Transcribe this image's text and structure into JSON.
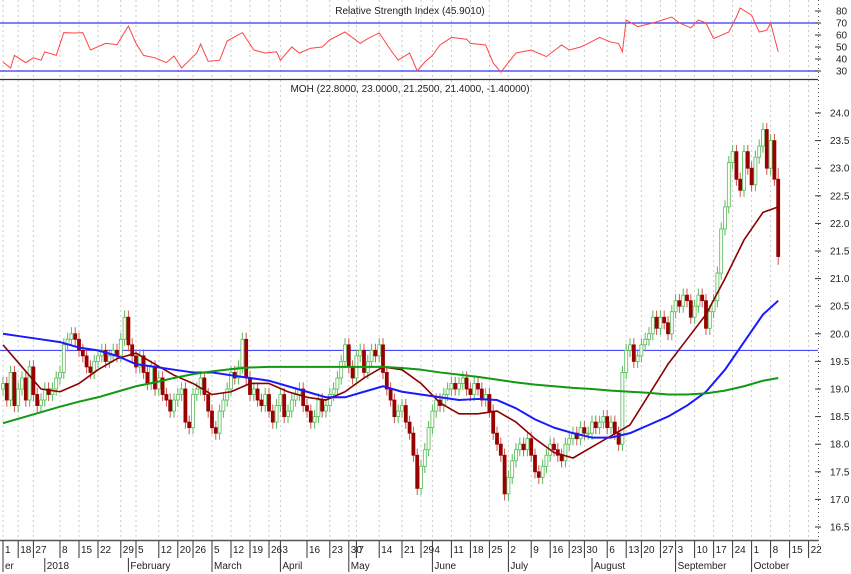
{
  "chart_data": {
    "type": "candlestick",
    "symbol": "MOH",
    "rsi_title": "Relative Strength Index (45.9010)",
    "price_title": "MOH (22.8000, 23.0000, 21.2500, 21.4000, -1.40000)",
    "last_bar": {
      "open": 22.8,
      "high": 23.0,
      "low": 21.25,
      "close": 21.4,
      "change": -1.4
    },
    "price_ylim": [
      16.25,
      24.5
    ],
    "price_ticks": [
      "24.0",
      "23.5",
      "23.0",
      "22.5",
      "22.0",
      "21.5",
      "21.0",
      "20.5",
      "20.0",
      "19.5",
      "19.0",
      "18.5",
      "18.0",
      "17.5",
      "17.0",
      "16.5"
    ],
    "rsi_ticks": [
      "80",
      "70",
      "60",
      "50",
      "40",
      "30"
    ],
    "rsi_levels": [
      70,
      30
    ],
    "price_hline": 19.7,
    "closes": [
      19.1,
      18.8,
      19.3,
      18.7,
      19.0,
      19.2,
      18.8,
      19.4,
      18.9,
      18.7,
      18.8,
      19.0,
      18.9,
      19.0,
      19.2,
      19.3,
      19.8,
      19.9,
      20.0,
      19.9,
      19.7,
      19.6,
      19.4,
      19.3,
      19.5,
      19.6,
      19.7,
      19.5,
      19.6,
      19.7,
      19.6,
      19.9,
      20.3,
      19.8,
      19.6,
      19.4,
      19.6,
      19.3,
      19.1,
      19.4,
      19.0,
      19.2,
      18.9,
      18.8,
      18.6,
      18.8,
      18.9,
      19.0,
      18.4,
      18.3,
      18.9,
      19.0,
      19.2,
      18.9,
      18.6,
      18.3,
      18.2,
      18.6,
      18.8,
      19.0,
      19.3,
      19.2,
      19.4,
      19.9,
      19.2,
      18.9,
      19.0,
      18.8,
      18.7,
      18.9,
      18.6,
      18.4,
      18.7,
      18.9,
      18.5,
      18.6,
      18.8,
      18.9,
      19.0,
      18.7,
      18.6,
      18.4,
      18.5,
      18.8,
      18.6,
      18.7,
      18.9,
      19.0,
      19.2,
      19.5,
      19.8,
      19.4,
      19.2,
      19.6,
      19.7,
      19.3,
      19.5,
      19.7,
      19.6,
      19.8,
      19.3,
      19.0,
      18.8,
      18.5,
      18.6,
      18.7,
      18.4,
      18.2,
      17.8,
      17.2,
      17.6,
      17.9,
      18.3,
      18.6,
      18.8,
      18.7,
      18.9,
      19.0,
      19.1,
      19.0,
      19.1,
      19.2,
      19.0,
      18.9,
      19.1,
      19.0,
      18.8,
      18.9,
      18.6,
      18.2,
      18.0,
      17.8,
      17.1,
      17.4,
      17.7,
      17.9,
      18.0,
      17.9,
      18.1,
      17.8,
      17.5,
      17.4,
      17.6,
      17.8,
      18.0,
      17.9,
      17.8,
      17.7,
      18.0,
      18.1,
      18.2,
      18.1,
      18.3,
      18.2,
      18.2,
      18.4,
      18.3,
      18.4,
      18.5,
      18.3,
      18.4,
      18.2,
      18.0,
      19.3,
      19.7,
      19.8,
      19.5,
      19.6,
      19.8,
      19.9,
      20.0,
      20.3,
      20.1,
      20.3,
      20.2,
      20.0,
      20.4,
      20.6,
      20.5,
      20.7,
      20.6,
      20.3,
      20.5,
      20.7,
      20.6,
      20.1,
      20.4,
      20.6,
      21.1,
      21.9,
      22.3,
      23.1,
      23.3,
      22.8,
      22.6,
      23.3,
      23.0,
      22.7,
      23.2,
      23.4,
      23.7,
      23.0,
      23.5,
      22.8,
      21.4
    ],
    "ma_sample_step": 5,
    "series": [
      {
        "name": "MA short",
        "color": "#8b0000",
        "values": [
          19.8,
          19.4,
          19.0,
          18.95,
          19.1,
          19.35,
          19.55,
          19.65,
          19.45,
          19.25,
          19.1,
          18.9,
          18.95,
          19.1,
          19.1,
          18.95,
          18.85,
          18.8,
          18.95,
          19.2,
          19.4,
          19.35,
          19.1,
          18.75,
          18.55,
          18.55,
          18.6,
          18.4,
          18.1,
          17.85,
          17.75,
          17.95,
          18.15,
          18.35,
          18.9,
          19.45,
          19.9,
          20.35,
          21.0,
          21.7,
          22.2,
          22.3
        ]
      },
      {
        "name": "MA medium",
        "color": "#1a1aff",
        "values": [
          20.0,
          19.95,
          19.9,
          19.85,
          19.75,
          19.7,
          19.6,
          19.45,
          19.4,
          19.35,
          19.3,
          19.3,
          19.25,
          19.2,
          19.15,
          19.05,
          18.95,
          18.85,
          18.85,
          18.95,
          19.05,
          18.95,
          18.9,
          18.85,
          18.8,
          18.82,
          18.8,
          18.65,
          18.45,
          18.3,
          18.2,
          18.12,
          18.12,
          18.2,
          18.35,
          18.5,
          18.7,
          18.95,
          19.35,
          19.85,
          20.35,
          20.6
        ]
      },
      {
        "name": "MA long",
        "color": "#119911",
        "values": [
          18.38,
          18.48,
          18.58,
          18.68,
          18.77,
          18.85,
          18.95,
          19.05,
          19.12,
          19.2,
          19.27,
          19.32,
          19.36,
          19.39,
          19.4,
          19.4,
          19.4,
          19.4,
          19.4,
          19.4,
          19.4,
          19.38,
          19.35,
          19.3,
          19.26,
          19.22,
          19.17,
          19.12,
          19.08,
          19.05,
          19.02,
          19.0,
          18.97,
          18.95,
          18.93,
          18.9,
          18.9,
          18.92,
          18.97,
          19.05,
          19.15,
          19.2
        ]
      }
    ],
    "rsi": [
      [
        0,
        37.5
      ],
      [
        2,
        32.5
      ],
      [
        3,
        43
      ],
      [
        6,
        37
      ],
      [
        8,
        41
      ],
      [
        10,
        39
      ],
      [
        11,
        46
      ],
      [
        14,
        43
      ],
      [
        16,
        62
      ],
      [
        19,
        61.7
      ],
      [
        21,
        62
      ],
      [
        23,
        47.5
      ],
      [
        27,
        53
      ],
      [
        30,
        52
      ],
      [
        33,
        67.5
      ],
      [
        35,
        53
      ],
      [
        37,
        43
      ],
      [
        40,
        41
      ],
      [
        43,
        37
      ],
      [
        45,
        42.5
      ],
      [
        47,
        32.5
      ],
      [
        51,
        45
      ],
      [
        52,
        52.5
      ],
      [
        54,
        38
      ],
      [
        57,
        39
      ],
      [
        59,
        55
      ],
      [
        63,
        62
      ],
      [
        66,
        47.5
      ],
      [
        69,
        45
      ],
      [
        72,
        46
      ],
      [
        73,
        39
      ],
      [
        76,
        50
      ],
      [
        78,
        45
      ],
      [
        81,
        49
      ],
      [
        84,
        50
      ],
      [
        86,
        56
      ],
      [
        90,
        62.5
      ],
      [
        94,
        53
      ],
      [
        96,
        57
      ],
      [
        99,
        61.7
      ],
      [
        102,
        47.5
      ],
      [
        104,
        39
      ],
      [
        107,
        45
      ],
      [
        109,
        30
      ],
      [
        111,
        37.5
      ],
      [
        113,
        43
      ],
      [
        115,
        51.7
      ],
      [
        118,
        58
      ],
      [
        122,
        56.5
      ],
      [
        123,
        53
      ],
      [
        127,
        51.7
      ],
      [
        129,
        36.7
      ],
      [
        131,
        29
      ],
      [
        135,
        45
      ],
      [
        139,
        47.5
      ],
      [
        143,
        42
      ],
      [
        147,
        51.7
      ],
      [
        149,
        47.5
      ],
      [
        152,
        50
      ],
      [
        154,
        53
      ],
      [
        157,
        58
      ],
      [
        160,
        54
      ],
      [
        162,
        53
      ],
      [
        163,
        46
      ],
      [
        164,
        72.5
      ],
      [
        167,
        67
      ],
      [
        171,
        70
      ],
      [
        176,
        75
      ],
      [
        178,
        70
      ],
      [
        181,
        66
      ],
      [
        183,
        72.5
      ],
      [
        185,
        70
      ],
      [
        187,
        57
      ],
      [
        191,
        62.5
      ],
      [
        193,
        75
      ],
      [
        194,
        82.5
      ],
      [
        197,
        76.5
      ],
      [
        199,
        62.5
      ],
      [
        201,
        64
      ],
      [
        202,
        70
      ],
      [
        204,
        46
      ]
    ],
    "date_ticks": [
      [
        "1",
        0
      ],
      [
        "18",
        4
      ],
      [
        "27",
        8
      ],
      [
        "8",
        15
      ],
      [
        "15",
        20
      ],
      [
        "22",
        25
      ],
      [
        "29",
        31
      ],
      [
        "5",
        35
      ],
      [
        "12",
        41
      ],
      [
        "20",
        46
      ],
      [
        "26",
        50
      ],
      [
        "5",
        55
      ],
      [
        "12",
        60
      ],
      [
        "19",
        65
      ],
      [
        "26",
        70
      ],
      [
        "3",
        73
      ],
      [
        "16",
        80
      ],
      [
        "23",
        86
      ],
      [
        "30",
        91
      ],
      [
        "7",
        93
      ],
      [
        "14",
        99
      ],
      [
        "21",
        105
      ],
      [
        "29",
        110
      ],
      [
        "4",
        113
      ],
      [
        "11",
        118
      ],
      [
        "18",
        123
      ],
      [
        "25",
        128
      ],
      [
        "2",
        133
      ],
      [
        "9",
        139
      ],
      [
        "16",
        144
      ],
      [
        "23",
        149
      ],
      [
        "30",
        153
      ],
      [
        "6",
        159
      ],
      [
        "13",
        164
      ],
      [
        "20",
        168
      ],
      [
        "27",
        173
      ],
      [
        "3",
        177
      ],
      [
        "10",
        182
      ],
      [
        "17",
        187
      ],
      [
        "24",
        192
      ],
      [
        "1",
        197
      ],
      [
        "8",
        202
      ],
      [
        "15",
        207
      ],
      [
        "22",
        212
      ]
    ],
    "month_labels": [
      [
        "er",
        0
      ],
      [
        "2018",
        11
      ],
      [
        "February",
        33
      ],
      [
        "March",
        55
      ],
      [
        "April",
        73
      ],
      [
        "May",
        91
      ],
      [
        "June",
        113
      ],
      [
        "July",
        133
      ],
      [
        "August",
        155
      ],
      [
        "September",
        177
      ],
      [
        "October",
        197
      ]
    ],
    "colors": {
      "up": "#55bb55",
      "down": "#990000",
      "rsi": "#ff4444",
      "level": "#3333ff",
      "grid": "#c8c8c8"
    }
  }
}
